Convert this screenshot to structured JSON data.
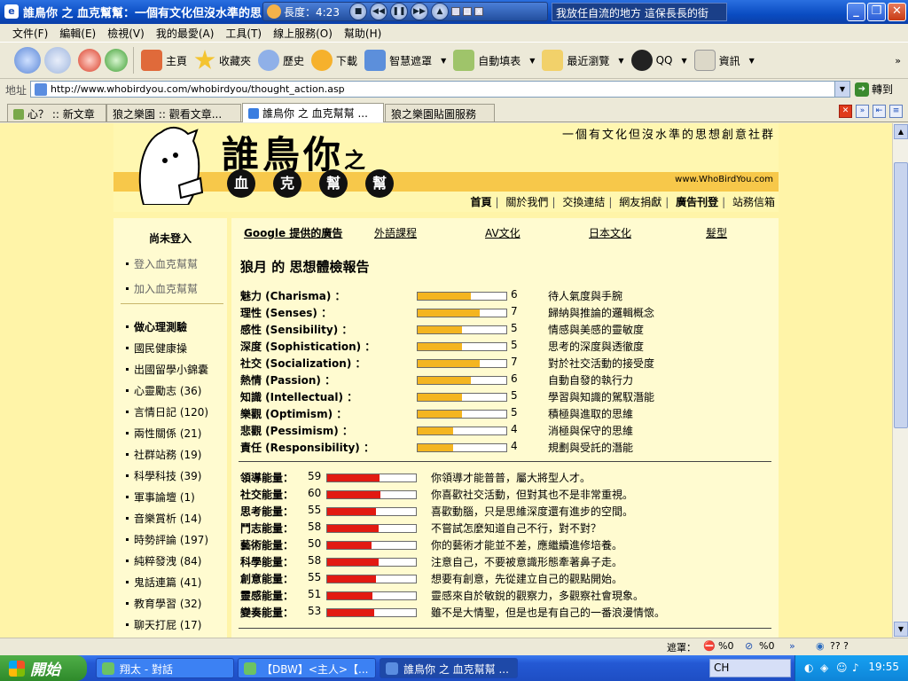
{
  "window": {
    "title": "誰鳥你 之 血克幫幫：一個有文化但沒水準的思",
    "player_time": "長度：4:23",
    "player_overlay": "Tencent Travel",
    "player_label": "LRC",
    "song_title": "我放任自流的地方 這保長長的街"
  },
  "menu": [
    "文件(F)",
    "編輯(E)",
    "檢視(V)",
    "我的最愛(A)",
    "工具(T)",
    "線上服務(O)",
    "幫助(H)"
  ],
  "toolbar": {
    "home": "主頁",
    "favorites": "收藏夾",
    "history": "歷史",
    "download": "下載",
    "smart_mask": "智慧遮罩",
    "autofill": "自動填表",
    "recent": "最近瀏覽",
    "qq": "QQ",
    "info": "資訊"
  },
  "address": {
    "label": "地址",
    "url": "http://www.whobirdyou.com/whobirdyou/thought_action.asp",
    "go": "轉到"
  },
  "tabs": [
    {
      "label": "心？ :: 新文章"
    },
    {
      "label": "狼之樂園 :: 觀看文章..."
    },
    {
      "label": "誰鳥你 之 血克幫幫 ..."
    },
    {
      "label": "狼之樂園貼圖服務"
    }
  ],
  "site": {
    "logo": "誰鳥你",
    "logo_suffix": "之",
    "logo_balls": [
      "血",
      "克",
      "幫",
      "幫"
    ],
    "slogan": "一個有文化但沒水準的思想創意社群",
    "url": "www.WhoBirdYou.com",
    "nav": [
      "首頁",
      "關於我們",
      "交換連結",
      "網友捐獻",
      "廣告刊登",
      "站務信箱"
    ]
  },
  "sidebar": {
    "login_title": "尚未登入",
    "links": [
      "登入血克幫幫",
      "加入血克幫幫"
    ],
    "items": [
      {
        "label": "做心理測驗"
      },
      {
        "label": "國民健康操"
      },
      {
        "label": "出國留學小錦囊"
      },
      {
        "label": "心靈勵志 (36)"
      },
      {
        "label": "言情日記 (120)"
      },
      {
        "label": "兩性關係 (21)"
      },
      {
        "label": "社群站務 (19)"
      },
      {
        "label": "科學科技 (39)"
      },
      {
        "label": "軍事論壇 (1)"
      },
      {
        "label": "音樂賞析 (14)"
      },
      {
        "label": "時勢評論 (197)"
      },
      {
        "label": "純粹發洩 (84)"
      },
      {
        "label": "鬼話連篇 (41)"
      },
      {
        "label": "教育學習 (32)"
      },
      {
        "label": "聊天打屁 (17)"
      }
    ]
  },
  "content": {
    "categories": [
      "Google 提供的廣告",
      "外語課程",
      "AV文化",
      "日本文化",
      "髮型"
    ],
    "report_title": "狼月 的 思想體檢報告",
    "traits": [
      {
        "name": "魅力 (Charisma) ：",
        "score": 6,
        "desc": "待人氣度與手腕"
      },
      {
        "name": "理性 (Senses) ：",
        "score": 7,
        "desc": "歸納與推論的邏輯概念"
      },
      {
        "name": "感性 (Sensibility) ：",
        "score": 5,
        "desc": "情感與美感的靈敏度"
      },
      {
        "name": "深度 (Sophistication) ：",
        "score": 5,
        "desc": "思考的深度與透徹度"
      },
      {
        "name": "社交 (Socialization) ：",
        "score": 7,
        "desc": "對於社交活動的接受度"
      },
      {
        "name": "熱情 (Passion) ：",
        "score": 6,
        "desc": "自動自發的執行力"
      },
      {
        "name": "知識 (Intellectual) ：",
        "score": 5,
        "desc": "學習與知識的駕馭潛能"
      },
      {
        "name": "樂觀 (Optimism) ：",
        "score": 5,
        "desc": "積極與進取的思維"
      },
      {
        "name": "悲觀 (Pessimism) ：",
        "score": 4,
        "desc": "消極與保守的思維"
      },
      {
        "name": "責任 (Responsibility) ：",
        "score": 4,
        "desc": "規劃與受託的潛能"
      }
    ],
    "trait_max": 10,
    "energies": [
      {
        "name": "領導能量：",
        "score": 59,
        "desc": "你領導才能普普，屬大將型人才。"
      },
      {
        "name": "社交能量：",
        "score": 60,
        "desc": "你喜歡社交活動，但對其也不是非常重視。"
      },
      {
        "name": "思考能量：",
        "score": 55,
        "desc": "喜歡動腦，只是思維深度還有進步的空間。"
      },
      {
        "name": "鬥志能量：",
        "score": 58,
        "desc": "不嘗試怎麼知道自己不行，對不對？"
      },
      {
        "name": "藝術能量：",
        "score": 50,
        "desc": "你的藝術才能並不差，應繼續進修培養。"
      },
      {
        "name": "科學能量：",
        "score": 58,
        "desc": "注意自己，不要被意識形態牽著鼻子走。"
      },
      {
        "name": "創意能量：",
        "score": 55,
        "desc": "想要有創意，先從建立自己的觀點開始。"
      },
      {
        "name": "靈感能量：",
        "score": 51,
        "desc": "靈感來自於敏銳的觀察力，多觀察社會現象。"
      },
      {
        "name": "變奏能量：",
        "score": 53,
        "desc": "雖不是大情聖，但是也是有自己的一番浪漫情懷。"
      }
    ],
    "energy_max": 100
  },
  "status": {
    "mask": "遮罩：",
    "pct1": "%0",
    "pct2": "%0",
    "q": "??  ?"
  },
  "taskbar": {
    "start": "開始",
    "tasks": [
      {
        "label": "翔太 - 對話"
      },
      {
        "label": "【DBW】<主人>【..."
      },
      {
        "label": "誰鳥你 之 血克幫幫 ..."
      }
    ],
    "lang": "CH",
    "clock": "19:55"
  },
  "colors": {
    "trait_fill": "#f4b520",
    "energy_fill": "#e21a12",
    "page_bg": "#fff4a8",
    "band": "#f7c84a"
  }
}
